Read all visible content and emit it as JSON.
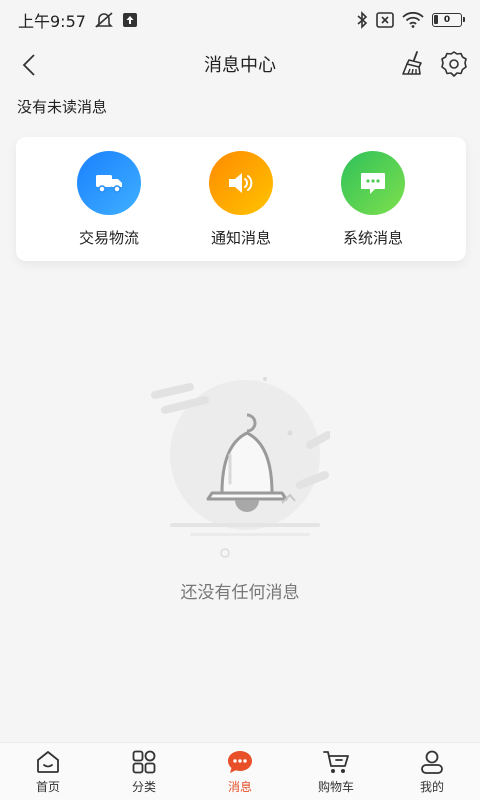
{
  "status_bar": {
    "time": "上午9:57",
    "battery_level": "0"
  },
  "nav": {
    "title": "消息中心"
  },
  "unread_note": "没有未读消息",
  "categories": [
    {
      "label": "交易物流",
      "icon": "truck-icon",
      "color": "#2b8ff5"
    },
    {
      "label": "通知消息",
      "icon": "speaker-icon",
      "color": "#ffa20a"
    },
    {
      "label": "系统消息",
      "icon": "chat-bubble-icon",
      "color": "#4ccb52"
    }
  ],
  "empty_state": {
    "text": "还没有任何消息",
    "icon": "bell-icon"
  },
  "tabs": [
    {
      "label": "首页",
      "icon": "home-icon",
      "active": false
    },
    {
      "label": "分类",
      "icon": "grid-icon",
      "active": false
    },
    {
      "label": "消息",
      "icon": "message-icon",
      "active": true
    },
    {
      "label": "购物车",
      "icon": "cart-icon",
      "active": false
    },
    {
      "label": "我的",
      "icon": "user-icon",
      "active": false
    }
  ],
  "colors": {
    "accent": "#e8502a",
    "background": "#f5f5f5"
  }
}
